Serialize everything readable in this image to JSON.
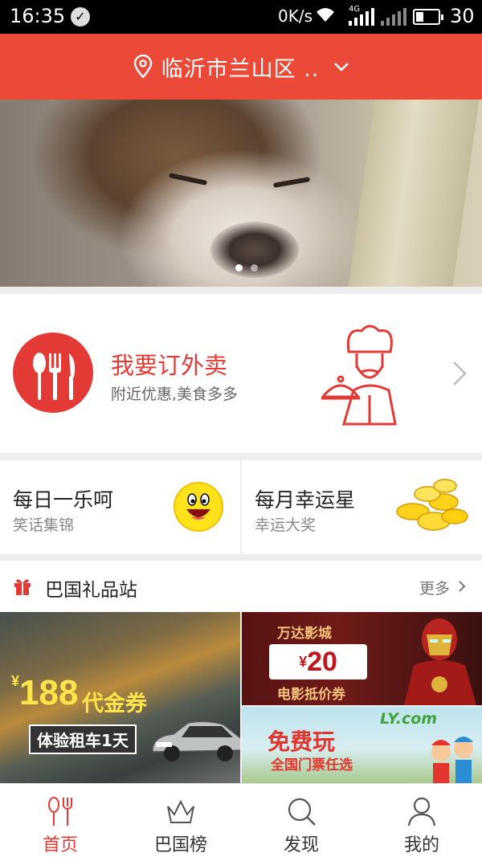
{
  "status_bar": {
    "time": "16:35",
    "net_speed": "0K/s",
    "network_type": "4G",
    "battery": "30"
  },
  "header": {
    "location": "临沂市兰山区 ..",
    "location_icon": "location-pin-icon",
    "dropdown_icon": "chevron-down-icon",
    "brand_color": "#ea4a37"
  },
  "banner": {
    "image": "sleeping-puppy-photo",
    "dots_total": 2,
    "dots_active": 1
  },
  "takeout": {
    "title": "我要订外卖",
    "subtitle": "附近优惠,美食多多",
    "icon": "fork-knife-spoon-icon",
    "illustration": "chef-icon"
  },
  "tiles": [
    {
      "title": "每日一乐呵",
      "subtitle": "笑话集锦",
      "icon": "smiley-face-icon"
    },
    {
      "title": "每月幸运星",
      "subtitle": "幸运大奖",
      "icon": "gold-coins-icon"
    }
  ],
  "gift_section": {
    "title": "巴国礼品站",
    "more": "更多",
    "icon": "gift-icon"
  },
  "promos": {
    "car": {
      "currency": "¥",
      "amount": "188",
      "label": "代金券",
      "tag": "体验租车1天"
    },
    "movie": {
      "brand": "万达影城",
      "currency": "¥",
      "amount": "20",
      "desc": "电影抵价券"
    },
    "tickets": {
      "logo": "LY.com",
      "title": "免费玩",
      "desc": "全国门票任选"
    }
  },
  "tabbar": {
    "active_color": "#e33a36",
    "items": [
      {
        "label": "首页",
        "icon": "food-home-icon"
      },
      {
        "label": "巴国榜",
        "icon": "crown-icon"
      },
      {
        "label": "发现",
        "icon": "search-icon"
      },
      {
        "label": "我的",
        "icon": "user-icon"
      }
    ]
  }
}
